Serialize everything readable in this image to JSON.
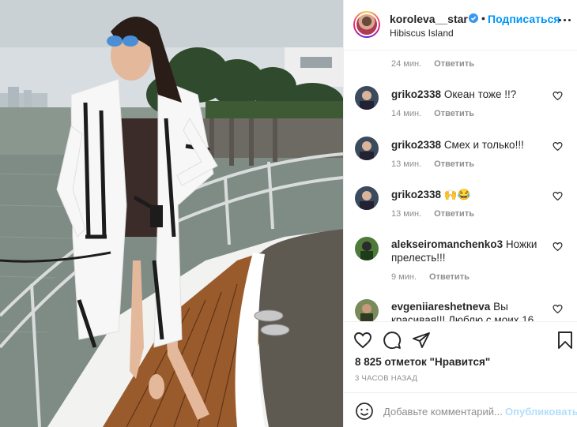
{
  "post": {
    "username": "koroleva__star",
    "separator": "•",
    "follow_label": "Подписаться",
    "location": "Hibiscus Island",
    "photo_alt": "Фото koroleva__star"
  },
  "comments": {
    "top_meta": {
      "time": "24 мин.",
      "reply": "Ответить"
    },
    "items": [
      {
        "user": "griko2338",
        "text": "Океан тоже !!?",
        "time": "14 мин.",
        "reply": "Ответить"
      },
      {
        "user": "griko2338",
        "text": "Смех и только!!!",
        "time": "13 мин.",
        "reply": "Ответить"
      },
      {
        "user": "griko2338",
        "text": "🙌😂",
        "time": "13 мин.",
        "reply": "Ответить"
      },
      {
        "user": "alekseiromanchenko3",
        "text": "Ножки прелесть!!!",
        "time": "9 мин.",
        "reply": "Ответить"
      },
      {
        "user": "evgeniiareshetneva",
        "text": "Вы красивая!!! Люблю с моих 16",
        "time": "",
        "reply": ""
      }
    ]
  },
  "actions": {
    "likes": "8 825 отметок \"Нравится\"",
    "time_ago": "3 ЧАСОВ НАЗАД"
  },
  "add_comment": {
    "placeholder": "Добавьте комментарий...",
    "publish_label": "Опубликовать"
  },
  "colors": {
    "accent": "#0095f6",
    "muted": "#8e8e8e",
    "text": "#262626",
    "publish_disabled": "#b2dffc"
  },
  "icons": {
    "verified": "verified-badge-icon",
    "more": "more-options-icon",
    "heart": "heart-icon",
    "comment": "comment-icon",
    "share": "share-icon",
    "bookmark": "bookmark-icon",
    "emoji": "emoji-icon"
  }
}
